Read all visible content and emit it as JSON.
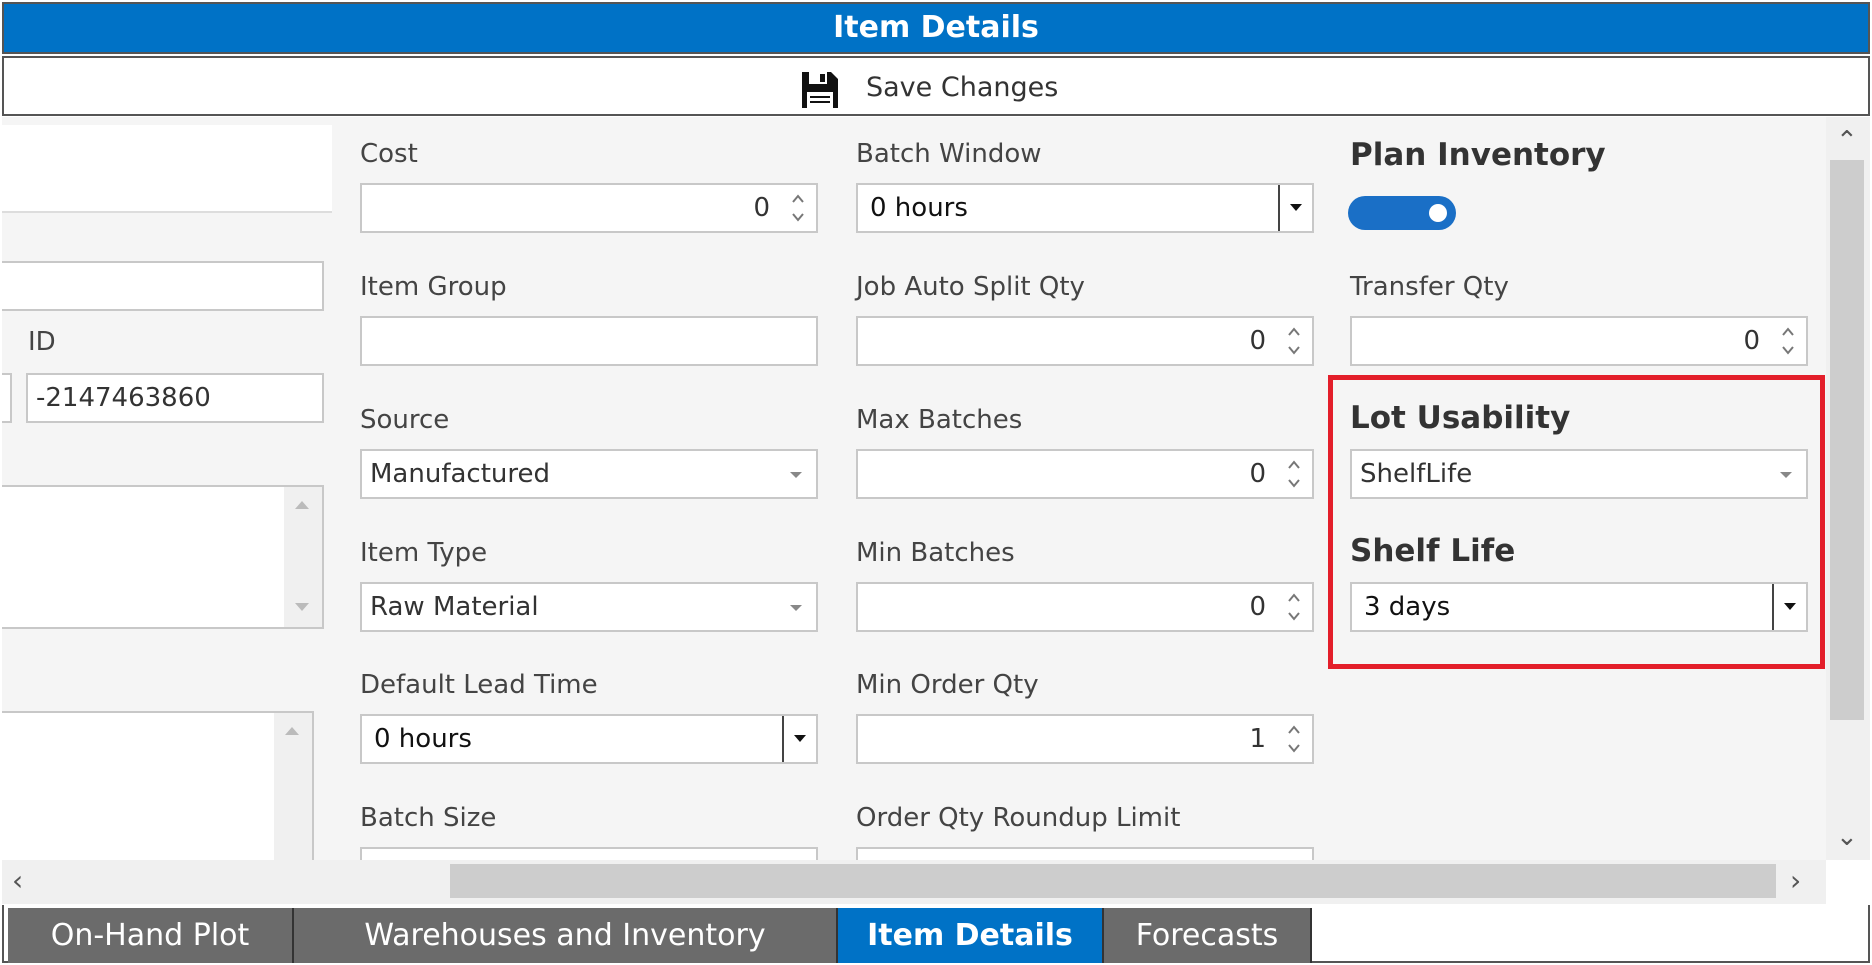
{
  "window": {
    "title": "Item Details"
  },
  "toolbar": {
    "save_label": "Save Changes",
    "save_icon": "floppy-disk-icon"
  },
  "left_panel": {
    "id_label": "ID",
    "id_value": "-2147463860"
  },
  "fields": {
    "cost": {
      "label": "Cost",
      "value": "0"
    },
    "item_group": {
      "label": "Item Group",
      "value": ""
    },
    "source": {
      "label": "Source",
      "value": "Manufactured"
    },
    "item_type": {
      "label": "Item Type",
      "value": "Raw Material"
    },
    "default_lead_time": {
      "label": "Default Lead Time",
      "value": "0 hours"
    },
    "batch_size": {
      "label": "Batch Size"
    },
    "batch_window": {
      "label": "Batch Window",
      "value": "0 hours"
    },
    "job_auto_split_qty": {
      "label": "Job Auto Split Qty",
      "value": "0"
    },
    "max_batches": {
      "label": "Max Batches",
      "value": "0"
    },
    "min_batches": {
      "label": "Min Batches",
      "value": "0"
    },
    "min_order_qty": {
      "label": "Min Order Qty",
      "value": "1"
    },
    "order_qty_roundup_limit": {
      "label": "Order Qty Roundup Limit"
    },
    "plan_inventory": {
      "label": "Plan Inventory",
      "on": true
    },
    "transfer_qty": {
      "label": "Transfer Qty",
      "value": "0"
    },
    "lot_usability": {
      "label": "Lot Usability",
      "value": "ShelfLife"
    },
    "shelf_life": {
      "label": "Shelf Life",
      "value": "3 days"
    }
  },
  "tabs": [
    {
      "label": "On-Hand Plot",
      "active": false
    },
    {
      "label": "Warehouses and Inventory",
      "active": false
    },
    {
      "label": "Item Details",
      "active": true
    },
    {
      "label": "Forecasts",
      "active": false
    }
  ],
  "colors": {
    "accent": "#0072c6",
    "highlight": "#e31e2a",
    "tab_inactive": "#6b6b6b"
  }
}
